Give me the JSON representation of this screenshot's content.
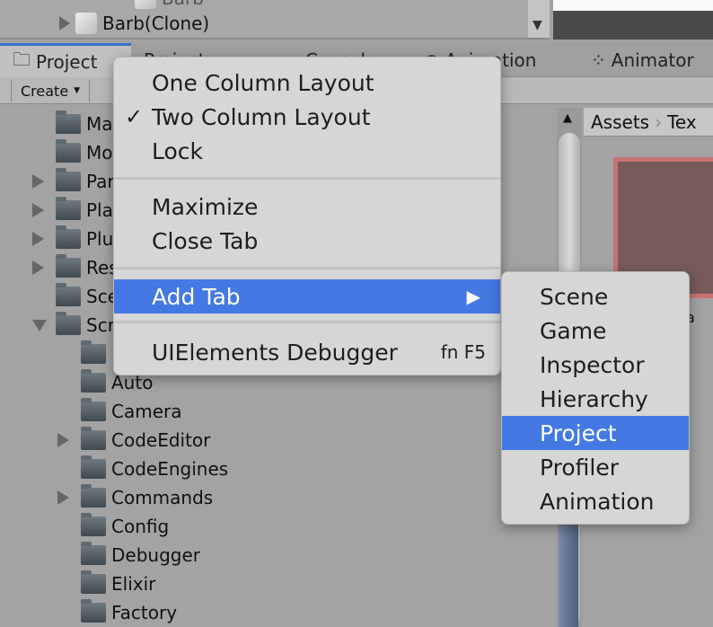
{
  "hierarchy": {
    "partial_item": "Barb",
    "item": "Barb(Clone)"
  },
  "tabs": [
    {
      "label": "Project",
      "active": true
    },
    {
      "label": "Project"
    },
    {
      "label": "Console"
    },
    {
      "label": "Animation"
    },
    {
      "label": "Animator"
    }
  ],
  "toolbar": {
    "create_label": "Create"
  },
  "tree": [
    {
      "label": "Ma",
      "depth": 0,
      "expander": "none"
    },
    {
      "label": "Mo",
      "depth": 0,
      "expander": "none"
    },
    {
      "label": "Par",
      "depth": 0,
      "expander": "collapsed"
    },
    {
      "label": "Pla",
      "depth": 0,
      "expander": "collapsed"
    },
    {
      "label": "Plu",
      "depth": 0,
      "expander": "collapsed"
    },
    {
      "label": "Res",
      "depth": 0,
      "expander": "collapsed"
    },
    {
      "label": "Sce",
      "depth": 0,
      "expander": "none"
    },
    {
      "label": "Scr",
      "depth": 0,
      "expander": "expanded"
    },
    {
      "label": "",
      "depth": 1,
      "expander": "none"
    },
    {
      "label": "Auto",
      "depth": 1,
      "expander": "none"
    },
    {
      "label": "Camera",
      "depth": 1,
      "expander": "none"
    },
    {
      "label": "CodeEditor",
      "depth": 1,
      "expander": "collapsed"
    },
    {
      "label": "CodeEngines",
      "depth": 1,
      "expander": "none"
    },
    {
      "label": "Commands",
      "depth": 1,
      "expander": "collapsed"
    },
    {
      "label": "Config",
      "depth": 1,
      "expander": "none"
    },
    {
      "label": "Debugger",
      "depth": 1,
      "expander": "none"
    },
    {
      "label": "Elixir",
      "depth": 1,
      "expander": "none"
    },
    {
      "label": "Factory",
      "depth": 1,
      "expander": "none"
    }
  ],
  "breadcrumb": {
    "root": "Assets",
    "next": "Tex"
  },
  "asset_label_partial": "a",
  "context_menu": {
    "items": [
      {
        "label": "One Column Layout"
      },
      {
        "label": "Two Column Layout",
        "checked": true
      },
      {
        "label": "Lock"
      },
      {
        "label": "Maximize"
      },
      {
        "label": "Close Tab"
      },
      {
        "label": "Add Tab",
        "highlighted": true,
        "submenu": true
      },
      {
        "label": "UIElements Debugger",
        "shortcut": "fn F5"
      }
    ],
    "check_glyph": "✓",
    "submenu_arrow": "▶"
  },
  "submenu": {
    "items": [
      "Scene",
      "Game",
      "Inspector",
      "Hierarchy",
      "Project",
      "Profiler",
      "Animation"
    ],
    "highlighted": "Project"
  },
  "colors": {
    "highlight": "#4479e3",
    "tab_active_border": "#3a70c8",
    "thumbnail_border": "#c87373"
  }
}
